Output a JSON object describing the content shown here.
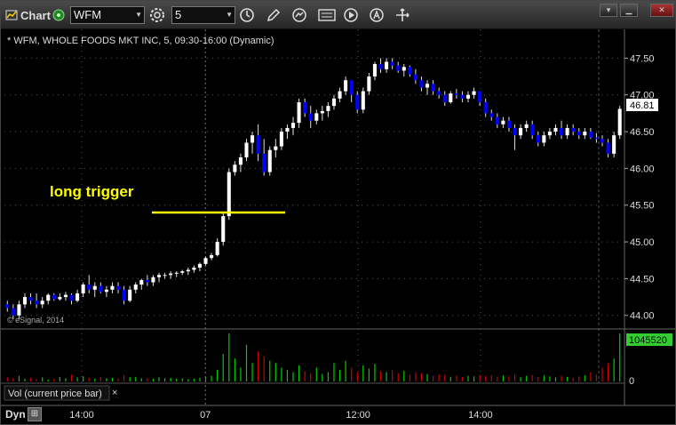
{
  "window": {
    "title": "Chart",
    "symbol": "WFM",
    "interval": "5",
    "toolbar_icons": [
      "settings-gear-icon",
      "clock-icon",
      "pencil-icon",
      "refresh-icon",
      "gci-icon",
      "play-icon",
      "a-circle-icon",
      "move-icon"
    ],
    "window_buttons": [
      "menu",
      "minimize",
      "close"
    ]
  },
  "chart": {
    "header": "* WFM, WHOLE FOODS MKT INC, 5, 09:30-16:00 (Dynamic)",
    "watermark": "© eSignal, 2014",
    "annotation": "long trigger",
    "annotation_color": "#ffff00",
    "last_price_label": "46.81",
    "volume_label": "1045520",
    "volume_zero_label": "0",
    "volume_panel_label": "Vol (current price bar)",
    "close_panel": "×",
    "status_label": "Dyn",
    "colors": {
      "up": "#ffffff",
      "down": "#0000ff",
      "vol_up": "#00cc00",
      "vol_down": "#cc0000",
      "grid": "#555555",
      "bg": "#000000"
    }
  },
  "chart_data": {
    "type": "candlestick",
    "title": "* WFM, WHOLE FOODS MKT INC, 5, 09:30-16:00 (Dynamic)",
    "ylim": [
      43.9,
      47.65
    ],
    "yticks": [
      "47.50",
      "47.00",
      "46.50",
      "46.00",
      "45.50",
      "45.00",
      "44.50",
      "44.00"
    ],
    "xticks": [
      "14:00",
      "07",
      "12:00",
      "14:00"
    ],
    "long_trigger_price": 45.4,
    "last_price": 46.81,
    "candles": [
      [
        44.15,
        44.2,
        44.05,
        44.1
      ],
      [
        44.1,
        44.15,
        43.95,
        44.0
      ],
      [
        44.0,
        44.2,
        43.95,
        44.15
      ],
      [
        44.15,
        44.3,
        44.1,
        44.25
      ],
      [
        44.25,
        44.3,
        44.15,
        44.2
      ],
      [
        44.2,
        44.3,
        44.1,
        44.15
      ],
      [
        44.15,
        44.25,
        44.1,
        44.2
      ],
      [
        44.2,
        44.3,
        44.15,
        44.28
      ],
      [
        44.28,
        44.3,
        44.2,
        44.22
      ],
      [
        44.22,
        44.3,
        44.2,
        44.25
      ],
      [
        44.25,
        44.32,
        44.2,
        44.28
      ],
      [
        44.28,
        44.3,
        44.15,
        44.2
      ],
      [
        44.2,
        44.35,
        44.18,
        44.3
      ],
      [
        44.3,
        44.45,
        44.25,
        44.42
      ],
      [
        44.42,
        44.55,
        44.3,
        44.35
      ],
      [
        44.35,
        44.45,
        44.25,
        44.4
      ],
      [
        44.4,
        44.45,
        44.3,
        44.32
      ],
      [
        44.32,
        44.4,
        44.25,
        44.35
      ],
      [
        44.35,
        44.45,
        44.3,
        44.4
      ],
      [
        44.4,
        44.45,
        44.3,
        44.35
      ],
      [
        44.35,
        44.4,
        44.15,
        44.2
      ],
      [
        44.2,
        44.4,
        44.18,
        44.35
      ],
      [
        44.35,
        44.45,
        44.3,
        44.42
      ],
      [
        44.42,
        44.5,
        44.35,
        44.48
      ],
      [
        44.48,
        44.55,
        44.4,
        44.45
      ],
      [
        44.45,
        44.55,
        44.4,
        44.52
      ],
      [
        44.52,
        44.58,
        44.45,
        44.55
      ],
      [
        44.55,
        44.58,
        44.5,
        44.55
      ],
      [
        44.55,
        44.6,
        44.5,
        44.57
      ],
      [
        44.57,
        44.6,
        44.52,
        44.58
      ],
      [
        44.58,
        44.62,
        44.55,
        44.6
      ],
      [
        44.6,
        44.65,
        44.55,
        44.62
      ],
      [
        44.62,
        44.68,
        44.58,
        44.65
      ],
      [
        44.65,
        44.72,
        44.6,
        44.7
      ],
      [
        44.7,
        44.8,
        44.68,
        44.78
      ],
      [
        44.78,
        44.85,
        44.75,
        44.82
      ],
      [
        44.82,
        45.05,
        44.8,
        45.0
      ],
      [
        45.0,
        45.4,
        44.95,
        45.35
      ],
      [
        45.35,
        46.0,
        45.3,
        45.95
      ],
      [
        45.95,
        46.1,
        45.9,
        46.05
      ],
      [
        46.05,
        46.2,
        45.95,
        46.15
      ],
      [
        46.15,
        46.4,
        46.1,
        46.35
      ],
      [
        46.35,
        46.5,
        46.2,
        46.45
      ],
      [
        46.45,
        46.6,
        46.1,
        46.2
      ],
      [
        46.2,
        46.4,
        45.9,
        45.95
      ],
      [
        45.95,
        46.3,
        45.9,
        46.25
      ],
      [
        46.25,
        46.4,
        46.15,
        46.3
      ],
      [
        46.3,
        46.55,
        46.25,
        46.5
      ],
      [
        46.5,
        46.6,
        46.4,
        46.55
      ],
      [
        46.55,
        46.7,
        46.45,
        46.62
      ],
      [
        46.62,
        46.95,
        46.55,
        46.9
      ],
      [
        46.9,
        46.95,
        46.7,
        46.75
      ],
      [
        46.75,
        46.85,
        46.55,
        46.65
      ],
      [
        46.65,
        46.8,
        46.6,
        46.75
      ],
      [
        46.75,
        46.85,
        46.65,
        46.78
      ],
      [
        46.78,
        46.9,
        46.7,
        46.85
      ],
      [
        46.85,
        47.0,
        46.8,
        46.95
      ],
      [
        46.95,
        47.1,
        46.9,
        47.05
      ],
      [
        47.05,
        47.25,
        47.0,
        47.2
      ],
      [
        47.2,
        47.15,
        46.9,
        47.0
      ],
      [
        47.0,
        47.05,
        46.75,
        46.8
      ],
      [
        46.8,
        47.1,
        46.75,
        47.05
      ],
      [
        47.05,
        47.3,
        47.0,
        47.25
      ],
      [
        47.25,
        47.45,
        47.2,
        47.42
      ],
      [
        47.42,
        47.5,
        47.3,
        47.35
      ],
      [
        47.35,
        47.5,
        47.3,
        47.45
      ],
      [
        47.45,
        47.5,
        47.35,
        47.4
      ],
      [
        47.4,
        47.45,
        47.3,
        47.33
      ],
      [
        47.33,
        47.42,
        47.25,
        47.38
      ],
      [
        47.38,
        47.4,
        47.25,
        47.28
      ],
      [
        47.28,
        47.35,
        47.15,
        47.2
      ],
      [
        47.2,
        47.25,
        47.05,
        47.1
      ],
      [
        47.1,
        47.2,
        47.0,
        47.15
      ],
      [
        47.15,
        47.2,
        47.0,
        47.05
      ],
      [
        47.05,
        47.1,
        46.95,
        47.0
      ],
      [
        47.0,
        47.05,
        46.85,
        46.9
      ],
      [
        46.9,
        47.05,
        46.88,
        47.02
      ],
      [
        47.02,
        47.08,
        46.95,
        47.0
      ],
      [
        47.0,
        47.05,
        46.9,
        46.95
      ],
      [
        46.95,
        47.05,
        46.9,
        47.0
      ],
      [
        47.0,
        47.1,
        46.95,
        47.05
      ],
      [
        47.05,
        47.0,
        46.85,
        46.9
      ],
      [
        46.9,
        46.95,
        46.7,
        46.75
      ],
      [
        46.75,
        46.8,
        46.65,
        46.7
      ],
      [
        46.7,
        46.75,
        46.55,
        46.6
      ],
      [
        46.6,
        46.7,
        46.55,
        46.65
      ],
      [
        46.65,
        46.7,
        46.5,
        46.55
      ],
      [
        46.55,
        46.6,
        46.25,
        46.45
      ],
      [
        46.45,
        46.6,
        46.4,
        46.55
      ],
      [
        46.55,
        46.65,
        46.5,
        46.6
      ],
      [
        46.6,
        46.65,
        46.4,
        46.45
      ],
      [
        46.45,
        46.5,
        46.3,
        46.35
      ],
      [
        46.35,
        46.5,
        46.3,
        46.45
      ],
      [
        46.45,
        46.55,
        46.4,
        46.5
      ],
      [
        46.5,
        46.6,
        46.45,
        46.55
      ],
      [
        46.55,
        46.65,
        46.4,
        46.45
      ],
      [
        46.45,
        46.6,
        46.4,
        46.55
      ],
      [
        46.55,
        46.6,
        46.45,
        46.5
      ],
      [
        46.5,
        46.55,
        46.4,
        46.45
      ],
      [
        46.45,
        46.55,
        46.4,
        46.5
      ],
      [
        46.5,
        46.55,
        46.4,
        46.42
      ],
      [
        46.42,
        46.48,
        46.35,
        46.4
      ],
      [
        46.4,
        46.45,
        46.3,
        46.35
      ],
      [
        46.35,
        46.4,
        46.15,
        46.2
      ],
      [
        46.2,
        46.5,
        46.15,
        46.45
      ],
      [
        46.45,
        46.85,
        46.4,
        46.81
      ]
    ],
    "volume_ylim": [
      0,
      1045520
    ],
    "volume": [
      90000,
      70000,
      120000,
      60000,
      80000,
      50000,
      90000,
      40000,
      60000,
      100000,
      70000,
      150000,
      90000,
      110000,
      80000,
      60000,
      100000,
      70000,
      80000,
      60000,
      140000,
      90000,
      100000,
      70000,
      80000,
      60000,
      90000,
      70000,
      80000,
      60000,
      70000,
      50000,
      60000,
      80000,
      100000,
      120000,
      250000,
      600000,
      1045520,
      500000,
      300000,
      800000,
      400000,
      650000,
      550000,
      450000,
      400000,
      300000,
      250000,
      200000,
      350000,
      220000,
      180000,
      300000,
      160000,
      200000,
      400000,
      250000,
      450000,
      300000,
      200000,
      350000,
      280000,
      380000,
      220000,
      200000,
      250000,
      180000,
      230000,
      150000,
      200000,
      180000,
      160000,
      120000,
      150000,
      140000,
      100000,
      130000,
      90000,
      120000,
      110000,
      150000,
      120000,
      140000,
      100000,
      130000,
      110000,
      150000,
      90000,
      120000,
      140000,
      100000,
      130000,
      110000,
      90000,
      120000,
      100000,
      80000,
      110000,
      130000,
      200000,
      150000,
      300000,
      400000,
      500000,
      1045520
    ]
  }
}
